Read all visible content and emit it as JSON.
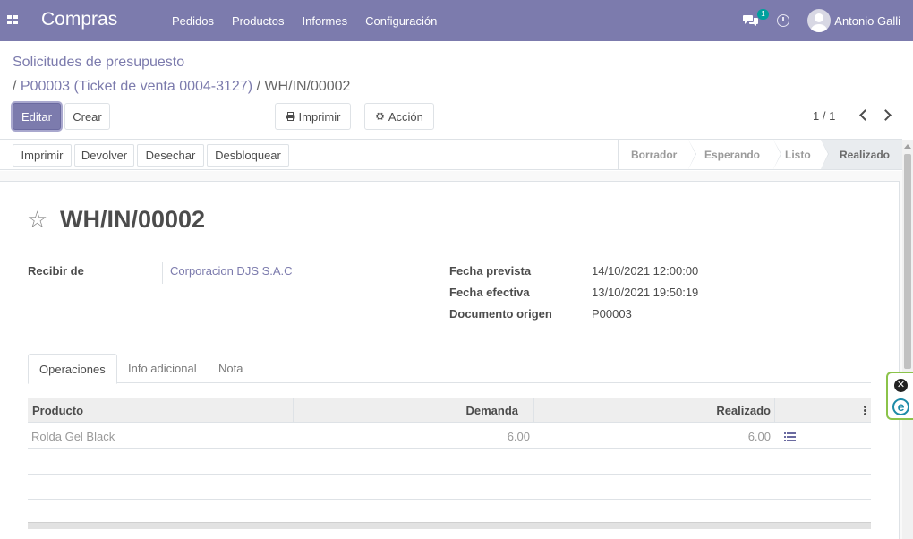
{
  "topbar": {
    "app_title": "Compras",
    "menu": [
      "Pedidos",
      "Productos",
      "Informes",
      "Configuración"
    ],
    "chat_count": "1",
    "user_name": "Antonio Galli",
    "color": "#7c7bad"
  },
  "breadcrumb": {
    "parent": "Solicitudes de presupuesto",
    "level2": "P00003 (Ticket de venta 0004-3127)",
    "current": "WH/IN/00002",
    "sep": "/"
  },
  "control": {
    "edit": "Editar",
    "create": "Crear",
    "print": "Imprimir",
    "action": "Acción",
    "pager": "1 / 1"
  },
  "statusbar": {
    "buttons": [
      "Imprimir",
      "Devolver",
      "Desechar",
      "Desbloquear"
    ],
    "stages": [
      "Borrador",
      "Esperando",
      "Listo",
      "Realizado"
    ],
    "active_stage": "Realizado"
  },
  "record": {
    "name": "WH/IN/00002",
    "fields_left": [
      {
        "label": "Recibir de",
        "value": "Corporacion DJS S.A.C"
      }
    ],
    "fields_right": [
      {
        "label": "Fecha prevista",
        "value": "14/10/2021 12:00:00"
      },
      {
        "label": "Fecha efectiva",
        "value": "13/10/2021 19:50:19"
      },
      {
        "label": "Documento origen",
        "value": "P00003"
      }
    ]
  },
  "tabs": [
    "Operaciones",
    "Info adicional",
    "Nota"
  ],
  "table": {
    "columns": [
      "Producto",
      "Demanda",
      "Realizado"
    ],
    "rows": [
      {
        "product": "Rolda Gel Black",
        "demand": "6.00",
        "done": "6.00"
      }
    ]
  }
}
